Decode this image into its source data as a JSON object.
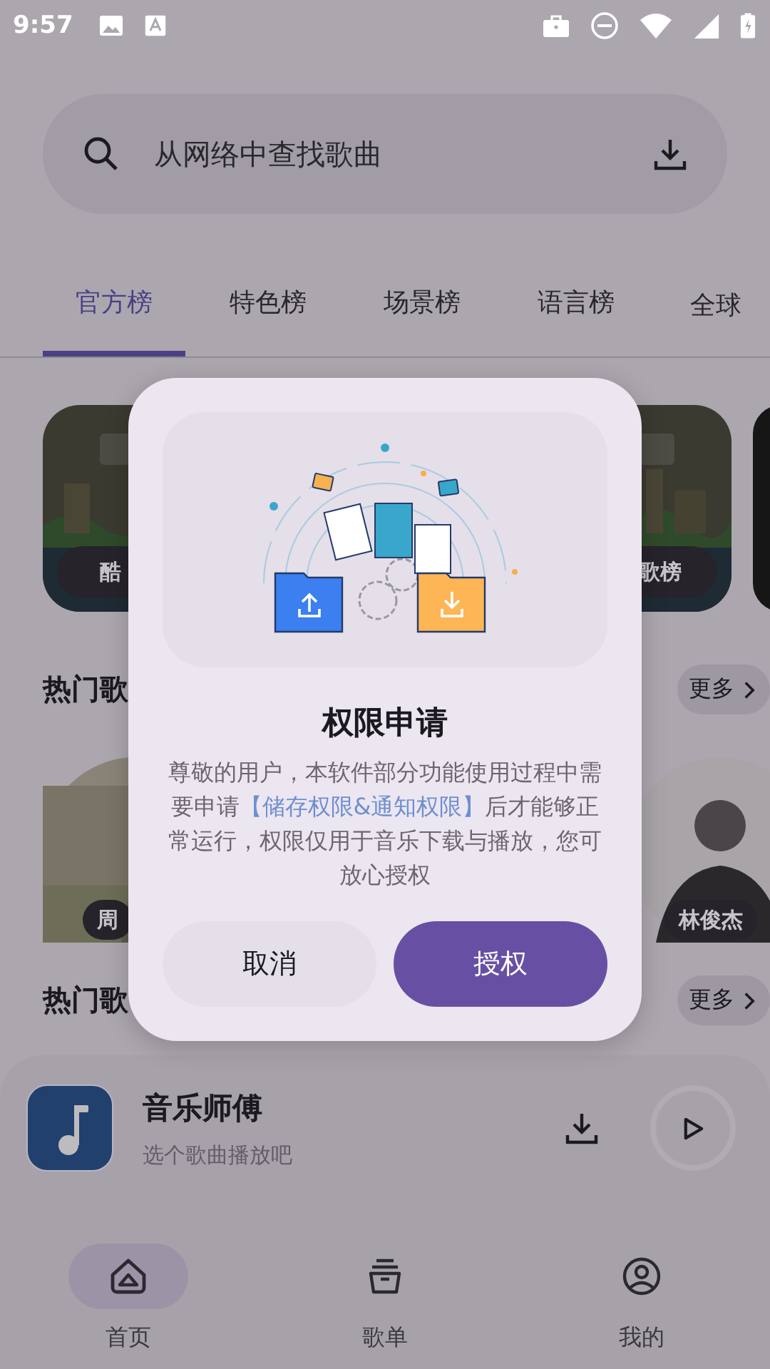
{
  "status_bar": {
    "time": "9:57"
  },
  "search": {
    "placeholder": "从网络中查找歌曲"
  },
  "tabs": [
    {
      "label": "官方榜",
      "selected": true
    },
    {
      "label": "特色榜",
      "selected": false
    },
    {
      "label": "场景榜",
      "selected": false
    },
    {
      "label": "语言榜",
      "selected": false
    },
    {
      "label": "全球",
      "selected": false
    }
  ],
  "chart_cards": [
    {
      "label": "酷"
    },
    {
      "label": "歌榜"
    }
  ],
  "sections": [
    {
      "title": "热门歌",
      "more": "更多"
    },
    {
      "title": "热门歌",
      "more": "更多"
    }
  ],
  "singers": [
    {
      "name": "周"
    },
    {
      "name": "林俊杰"
    }
  ],
  "player": {
    "title": "音乐师傅",
    "subtitle": "选个歌曲播放吧"
  },
  "nav": [
    {
      "label": "首页",
      "selected": true
    },
    {
      "label": "歌单",
      "selected": false
    },
    {
      "label": "我的",
      "selected": false
    }
  ],
  "dialog": {
    "title": "权限申请",
    "message": [
      {
        "kind": "plain",
        "text": "尊敬的用户，本软件部分功能使用过程中需要申请"
      },
      {
        "kind": "highlight",
        "text": "【储存权限&通知权限】"
      },
      {
        "kind": "plain",
        "text": "后才能够正常运行，权限仅用于音乐下载与播放，您可放心授权"
      }
    ],
    "cancel": "取消",
    "confirm": "授权"
  }
}
